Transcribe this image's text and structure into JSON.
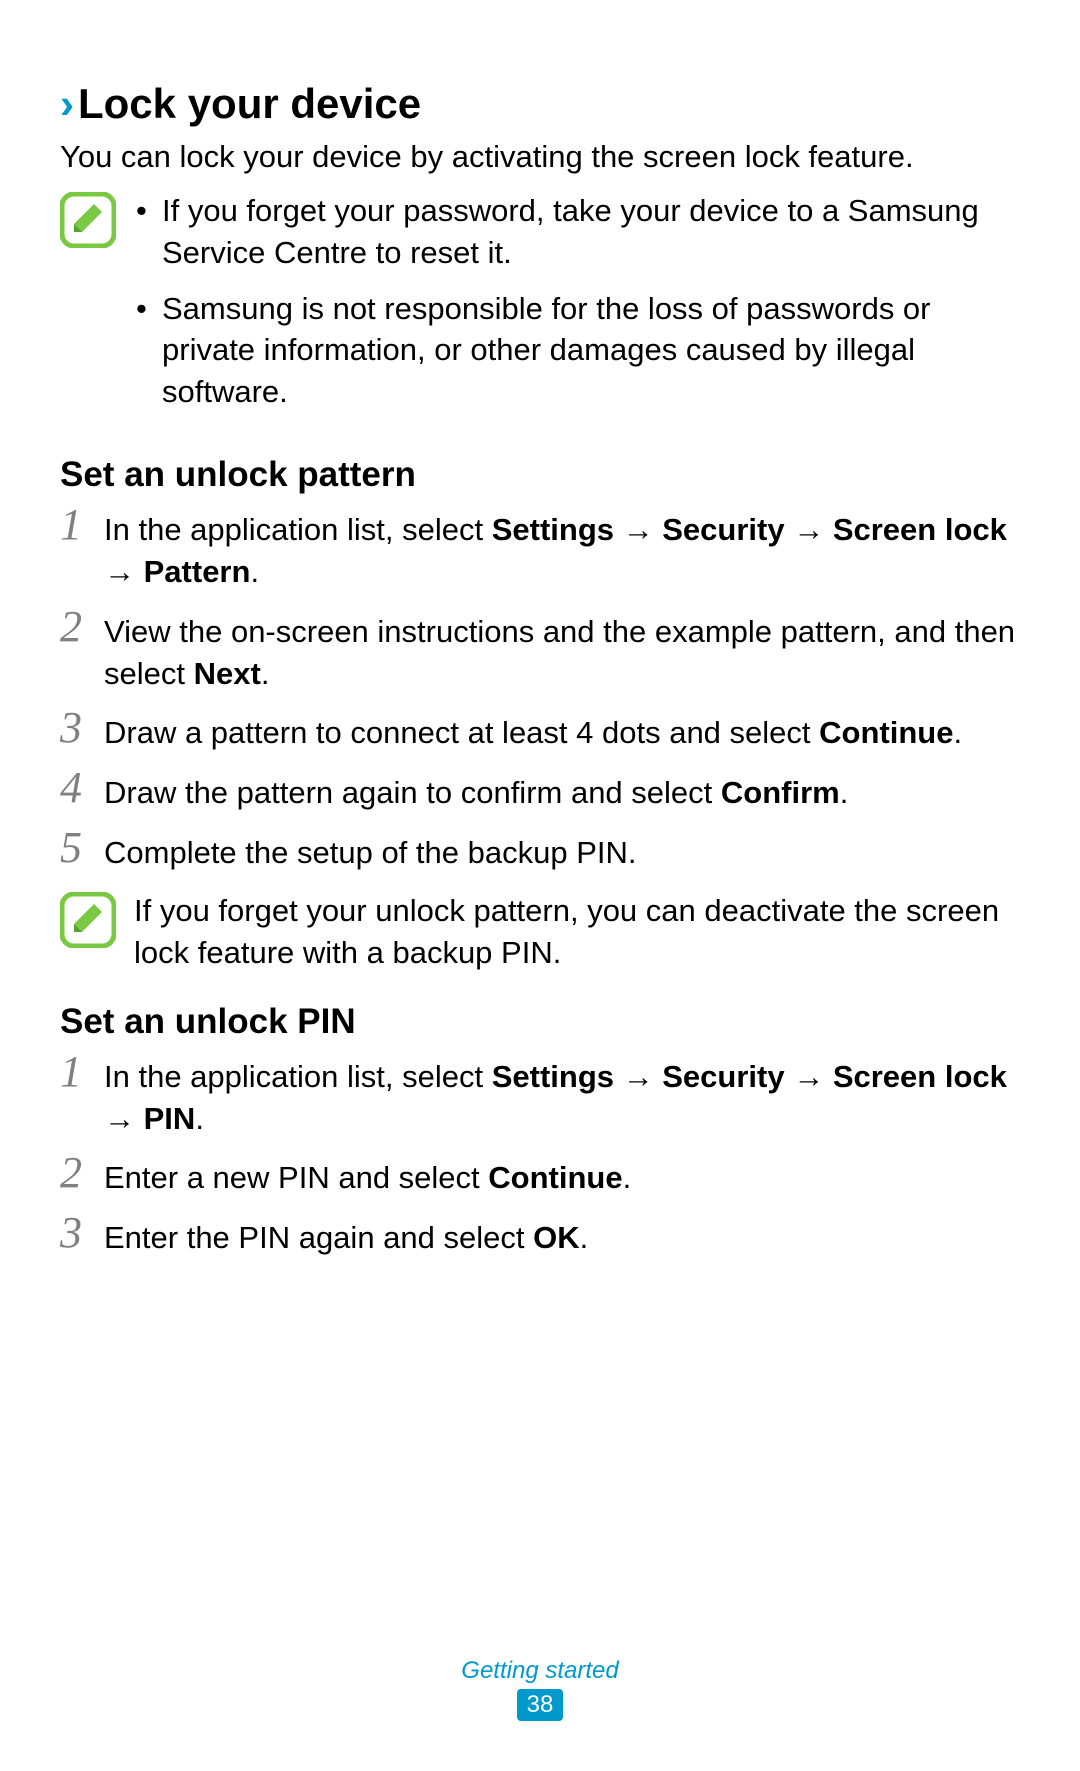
{
  "heading": {
    "title": "Lock your device"
  },
  "intro": "You can lock your device by activating the screen lock feature.",
  "note1": {
    "bullets": [
      "If you forget your password, take your device to a Samsung Service Centre to reset it.",
      "Samsung is not responsible for the loss of passwords or private information, or other damages caused by illegal software."
    ]
  },
  "subsection1": {
    "title": "Set an unlock pattern",
    "steps": {
      "n1": "1",
      "s1_prefix": "In the application list, select ",
      "s1_b1": "Settings",
      "s1_arrow": " → ",
      "s1_b2": "Security",
      "s1_b3": "Screen lock",
      "s1_b4": "Pattern",
      "s1_period": ".",
      "n2": "2",
      "s2_prefix": "View the on-screen instructions and the example pattern, and then select ",
      "s2_b1": "Next",
      "s2_period": ".",
      "n3": "3",
      "s3_prefix": "Draw a pattern to connect at least 4 dots and select ",
      "s3_b1": "Continue",
      "s3_period": ".",
      "n4": "4",
      "s4_prefix": "Draw the pattern again to confirm and select ",
      "s4_b1": "Confirm",
      "s4_period": ".",
      "n5": "5",
      "s5": "Complete the setup of the backup PIN."
    }
  },
  "note2": {
    "text": "If you forget your unlock pattern, you can deactivate the screen lock feature with a backup PIN."
  },
  "subsection2": {
    "title": "Set an unlock PIN",
    "steps": {
      "n1": "1",
      "s1_prefix": "In the application list, select ",
      "s1_b1": "Settings",
      "s1_arrow": " → ",
      "s1_b2": "Security",
      "s1_b3": "Screen lock",
      "s1_b4": "PIN",
      "s1_period": ".",
      "n2": "2",
      "s2_prefix": "Enter a new PIN and select ",
      "s2_b1": "Continue",
      "s2_period": ".",
      "n3": "3",
      "s3_prefix": "Enter the PIN again and select ",
      "s3_b1": "OK",
      "s3_period": "."
    }
  },
  "footer": {
    "category": "Getting started",
    "page": "38"
  }
}
